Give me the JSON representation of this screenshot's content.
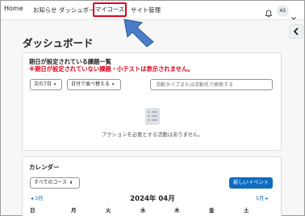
{
  "nav": {
    "home": "Home",
    "news": "お知らせ",
    "dashboard": "ダッシュボード",
    "my_courses": "マイコース",
    "site_admin": "サイト管理",
    "bell_icon": "bell-icon",
    "avatar_initials": "AS",
    "user_menu_icon": "chevron-down-icon"
  },
  "highlight_color": "#e0001b",
  "arrow_color": "#4a7cc7",
  "page": {
    "title": "ダッシュボード"
  },
  "timeline": {
    "title": "期日が設定されている課題一覧",
    "warning": "※期日が設定されていない課題・小テストは表示されません。",
    "filter_days": "次の7日",
    "sort_label": "日付で並べ替える",
    "search_placeholder": "活動タイプまたは活動名で検索する",
    "empty_icon": "clipboard-list-icon",
    "empty_message": "アクションを必要とする活動はありません。"
  },
  "calendar": {
    "title": "カレンダー",
    "course_select": "すべてのコース",
    "new_event": "新しいイベント",
    "prev_month": "3月",
    "current_month": "2024年 04月",
    "next_month": "5月",
    "weekdays": [
      "日",
      "月",
      "火",
      "水",
      "木",
      "金",
      "土"
    ]
  },
  "accent_color": "#0f6cbf"
}
